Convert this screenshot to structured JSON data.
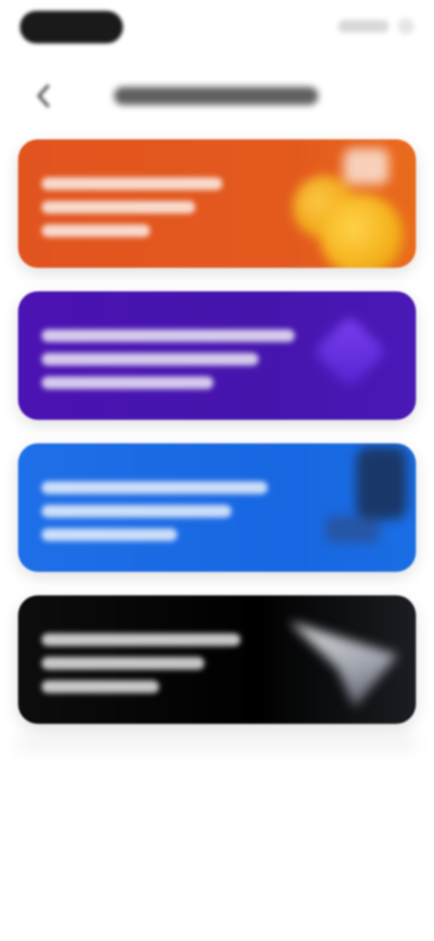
{
  "header": {
    "title": "",
    "back_icon": "back-arrow-icon"
  },
  "cards": [
    {
      "color": "#e2541f",
      "art_icon": "coins-icon"
    },
    {
      "color": "#4b13b3",
      "art_icon": "gem-icon"
    },
    {
      "color": "#1f6fe8",
      "art_icon": "device-icon"
    },
    {
      "color": "#000000",
      "art_icon": "paper-plane-icon"
    }
  ],
  "colors": {
    "background": "#ffffff",
    "orange": "#e2541f",
    "purple": "#4b13b3",
    "blue": "#1f6fe8",
    "black": "#000000"
  }
}
